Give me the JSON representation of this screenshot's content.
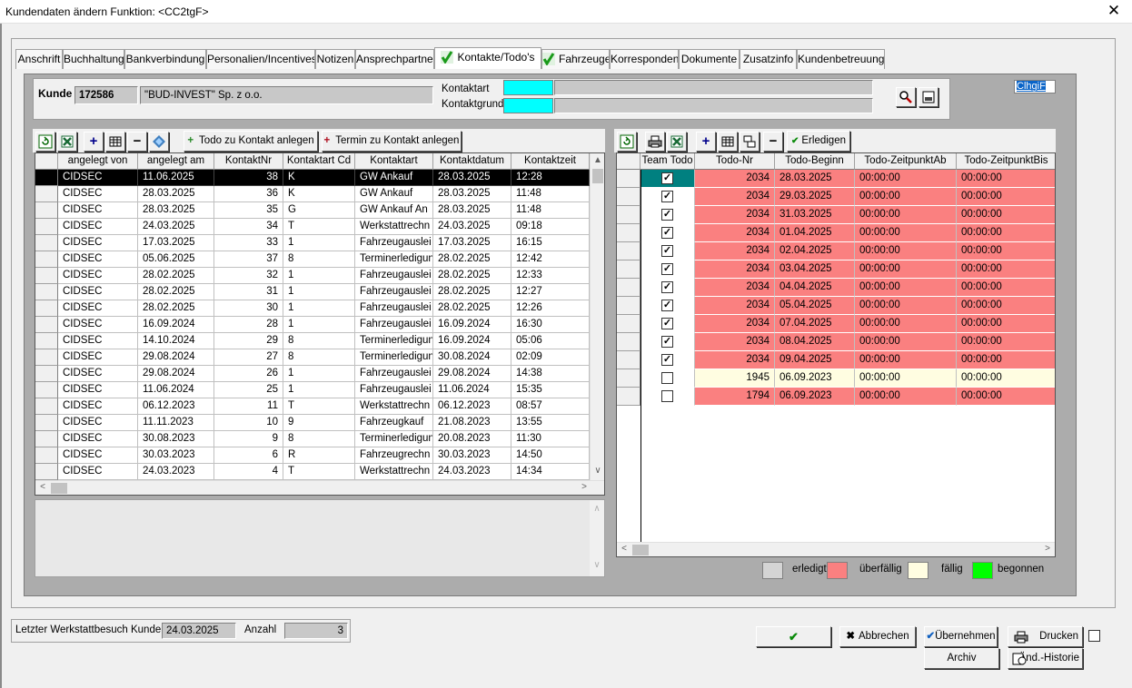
{
  "window": {
    "title": "Kundendaten ändern   Funktion: <CC2tgF>",
    "close_glyph": "✕"
  },
  "tabs": [
    {
      "label": "Anschrift",
      "checked": false
    },
    {
      "label": "Buchhaltung",
      "checked": false
    },
    {
      "label": "Bankverbindung",
      "checked": false
    },
    {
      "label": "Personalien/Incentives",
      "checked": false
    },
    {
      "label": "Notizen",
      "checked": false
    },
    {
      "label": "Ansprechpartner",
      "checked": false
    },
    {
      "label": "Kontakte/Todo's",
      "checked": true,
      "active": true
    },
    {
      "label": "Fahrzeuge",
      "checked": true
    },
    {
      "label": "Korrespondenz",
      "checked": false
    },
    {
      "label": "Dokumente",
      "checked": false
    },
    {
      "label": "Zusatzinfo",
      "checked": false
    },
    {
      "label": "Kundenbetreuung",
      "checked": false
    }
  ],
  "customer": {
    "label": "Kunde",
    "number": "172586",
    "name": "\"BUD-INVEST\" Sp. z o.o.",
    "kontaktart_label": "Kontaktart",
    "kontaktgrund_label": "Kontaktgrund",
    "clhgif": "ClhgiF"
  },
  "left_toolbar": {
    "todo_button": "Todo zu Kontakt anlegen",
    "termin_button": "Termin zu Kontakt anlegen"
  },
  "right_toolbar": {
    "erledigen_button": "Erledigen"
  },
  "contacts": {
    "columns": [
      "angelegt von",
      "angelegt am",
      "KontaktNr",
      "Kontaktart Cd",
      "Kontaktart",
      "Kontaktdatum",
      "Kontaktzeit"
    ],
    "rows": [
      [
        "CIDSEC",
        "11.06.2025",
        "38",
        "K",
        "GW Ankauf",
        "28.03.2025",
        "12:28"
      ],
      [
        "CIDSEC",
        "28.03.2025",
        "36",
        "K",
        "GW Ankauf",
        "28.03.2025",
        "11:48"
      ],
      [
        "CIDSEC",
        "28.03.2025",
        "35",
        "G",
        "GW Ankauf An",
        "28.03.2025",
        "11:48"
      ],
      [
        "CIDSEC",
        "24.03.2025",
        "34",
        "T",
        "Werkstattrechn",
        "24.03.2025",
        "09:18"
      ],
      [
        "CIDSEC",
        "17.03.2025",
        "33",
        "1",
        "Fahrzeugauslei",
        "17.03.2025",
        "16:15"
      ],
      [
        "CIDSEC",
        "05.06.2025",
        "37",
        "8",
        "Terminerledigun",
        "28.02.2025",
        "12:42"
      ],
      [
        "CIDSEC",
        "28.02.2025",
        "32",
        "1",
        "Fahrzeugauslei",
        "28.02.2025",
        "12:33"
      ],
      [
        "CIDSEC",
        "28.02.2025",
        "31",
        "1",
        "Fahrzeugauslei",
        "28.02.2025",
        "12:27"
      ],
      [
        "CIDSEC",
        "28.02.2025",
        "30",
        "1",
        "Fahrzeugauslei",
        "28.02.2025",
        "12:26"
      ],
      [
        "CIDSEC",
        "16.09.2024",
        "28",
        "1",
        "Fahrzeugauslei",
        "16.09.2024",
        "16:30"
      ],
      [
        "CIDSEC",
        "14.10.2024",
        "29",
        "8",
        "Terminerledigun",
        "16.09.2024",
        "05:06"
      ],
      [
        "CIDSEC",
        "29.08.2024",
        "27",
        "8",
        "Terminerledigun",
        "30.08.2024",
        "02:09"
      ],
      [
        "CIDSEC",
        "29.08.2024",
        "26",
        "1",
        "Fahrzeugauslei",
        "29.08.2024",
        "14:38"
      ],
      [
        "CIDSEC",
        "11.06.2024",
        "25",
        "1",
        "Fahrzeugauslei",
        "11.06.2024",
        "15:35"
      ],
      [
        "CIDSEC",
        "06.12.2023",
        "11",
        "T",
        "Werkstattrechn",
        "06.12.2023",
        "08:57"
      ],
      [
        "CIDSEC",
        "11.11.2023",
        "10",
        "9",
        "Fahrzeugkauf",
        "21.08.2023",
        "13:55"
      ],
      [
        "CIDSEC",
        "30.08.2023",
        "9",
        "8",
        "Terminerledigun",
        "20.08.2023",
        "11:30"
      ],
      [
        "CIDSEC",
        "30.03.2023",
        "6",
        "R",
        "Fahrzeugrechn",
        "30.03.2023",
        "14:50"
      ],
      [
        "CIDSEC",
        "24.03.2023",
        "4",
        "T",
        "Werkstattrechn",
        "24.03.2023",
        "14:34"
      ]
    ]
  },
  "todos": {
    "columns": [
      "Team Todo",
      "Todo-Nr",
      "Todo-Beginn",
      "Todo-ZeitpunktAb",
      "Todo-ZeitpunktBis"
    ],
    "rows": [
      {
        "checked": true,
        "nr": "2034",
        "beginn": "28.03.2025",
        "ab": "00:00:00",
        "bis": "00:00:00",
        "status": "overdue",
        "selected": true
      },
      {
        "checked": true,
        "nr": "2034",
        "beginn": "29.03.2025",
        "ab": "00:00:00",
        "bis": "00:00:00",
        "status": "overdue"
      },
      {
        "checked": true,
        "nr": "2034",
        "beginn": "31.03.2025",
        "ab": "00:00:00",
        "bis": "00:00:00",
        "status": "overdue"
      },
      {
        "checked": true,
        "nr": "2034",
        "beginn": "01.04.2025",
        "ab": "00:00:00",
        "bis": "00:00:00",
        "status": "overdue"
      },
      {
        "checked": true,
        "nr": "2034",
        "beginn": "02.04.2025",
        "ab": "00:00:00",
        "bis": "00:00:00",
        "status": "overdue"
      },
      {
        "checked": true,
        "nr": "2034",
        "beginn": "03.04.2025",
        "ab": "00:00:00",
        "bis": "00:00:00",
        "status": "overdue"
      },
      {
        "checked": true,
        "nr": "2034",
        "beginn": "04.04.2025",
        "ab": "00:00:00",
        "bis": "00:00:00",
        "status": "overdue"
      },
      {
        "checked": true,
        "nr": "2034",
        "beginn": "05.04.2025",
        "ab": "00:00:00",
        "bis": "00:00:00",
        "status": "overdue"
      },
      {
        "checked": true,
        "nr": "2034",
        "beginn": "07.04.2025",
        "ab": "00:00:00",
        "bis": "00:00:00",
        "status": "overdue"
      },
      {
        "checked": true,
        "nr": "2034",
        "beginn": "08.04.2025",
        "ab": "00:00:00",
        "bis": "00:00:00",
        "status": "overdue"
      },
      {
        "checked": true,
        "nr": "2034",
        "beginn": "09.04.2025",
        "ab": "00:00:00",
        "bis": "00:00:00",
        "status": "overdue"
      },
      {
        "checked": false,
        "nr": "1945",
        "beginn": "06.09.2023",
        "ab": "00:00:00",
        "bis": "00:00:00",
        "status": "due"
      },
      {
        "checked": false,
        "nr": "1794",
        "beginn": "06.09.2023",
        "ab": "00:00:00",
        "bis": "00:00:00",
        "status": "overdue"
      }
    ]
  },
  "legend": [
    {
      "label": "erledigt",
      "color": "#d4d4d4"
    },
    {
      "label": "überfällig",
      "color": "#fa8080"
    },
    {
      "label": "fällig",
      "color": "#fffde1"
    },
    {
      "label": "begonnen",
      "color": "#00ff00"
    }
  ],
  "colors": {
    "overdue_row": "#fa8080",
    "due_row": "#fffde1",
    "selected_cell": "#008080"
  },
  "footer": {
    "werkstatt_label": "Letzter Werkstattbesuch Kunde",
    "werkstatt_value": "24.03.2025",
    "anzahl_label": "Anzahl",
    "anzahl_value": "3"
  },
  "buttons": {
    "ok": "",
    "abbrechen": "Abbrechen",
    "uebernehmen": "Übernehmen",
    "drucken": "Drucken",
    "archiv": "Archiv",
    "historie": "Änd.-Historie"
  }
}
